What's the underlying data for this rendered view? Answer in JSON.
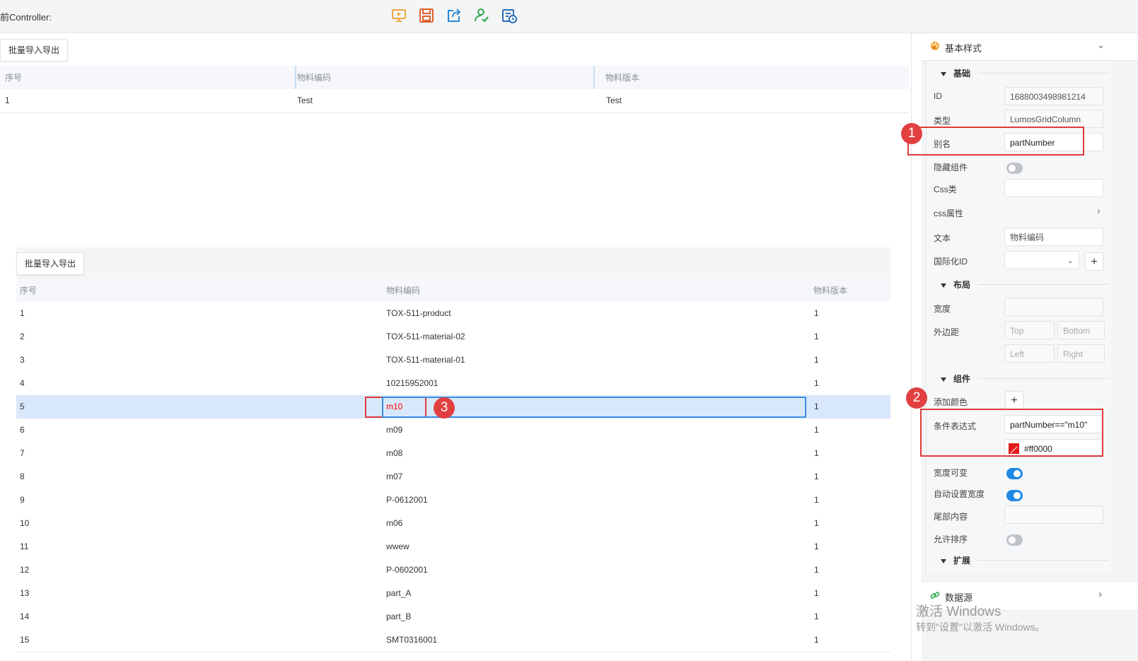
{
  "toolbar": {
    "controller_label": "前Controller:",
    "icons": [
      "preview-icon",
      "save-icon",
      "share-icon",
      "user-check-icon",
      "schedule-icon"
    ]
  },
  "canvas": {
    "top_grid": {
      "button_label": "批量导入导出",
      "columns": [
        "序号",
        "物料编码",
        "物料版本"
      ],
      "row": [
        "1",
        "Test",
        "Test"
      ]
    },
    "bottom_grid": {
      "button_label": "批量导入导出",
      "columns": [
        "序号",
        "物料编码",
        "物料版本"
      ],
      "rows": [
        [
          "1",
          "TOX-511-product",
          "1"
        ],
        [
          "2",
          "TOX-511-material-02",
          "1"
        ],
        [
          "3",
          "TOX-511-material-01",
          "1"
        ],
        [
          "4",
          "10215952001",
          "1"
        ],
        [
          "5",
          "m10",
          "1"
        ],
        [
          "6",
          "m09",
          "1"
        ],
        [
          "7",
          "m08",
          "1"
        ],
        [
          "8",
          "m07",
          "1"
        ],
        [
          "9",
          "P-0612001",
          "1"
        ],
        [
          "10",
          "m06",
          "1"
        ],
        [
          "11",
          "wwew",
          "1"
        ],
        [
          "12",
          "P-0602001",
          "1"
        ],
        [
          "13",
          "part_A",
          "1"
        ],
        [
          "14",
          "part_B",
          "1"
        ],
        [
          "15",
          "SMT0316001",
          "1"
        ]
      ],
      "selected_row": "5",
      "highlight_color": "#ff0000"
    }
  },
  "panel": {
    "header": "基本样式",
    "sections": {
      "basic": "基础",
      "layout": "布局",
      "component": "组件",
      "extend": "扩展"
    },
    "fields": {
      "id_label": "ID",
      "id_value": "1688003498981214",
      "type_label": "类型",
      "type_value": "LumosGridColumn",
      "alias_label": "别名",
      "alias_value": "partNumber",
      "hide_label": "隐藏组件",
      "css_class_label": "Css类",
      "css_attr_label": "css属性",
      "text_label": "文本",
      "text_value": "物料编码",
      "i18n_label": "国际化ID",
      "width_label": "宽度",
      "margin_label": "外边距",
      "margin_top": "Top",
      "margin_bottom": "Bottom",
      "margin_left": "Left",
      "margin_right": "Right",
      "add_color_label": "添加颜色",
      "condition_label": "条件表达式",
      "condition_value": "partNumber==\"m10\"",
      "color_value": "#ff0000",
      "resizable_label": "宽度可变",
      "auto_width_label": "自动设置宽度",
      "footer_label": "尾部内容",
      "sortable_label": "允许排序"
    },
    "toggles": {
      "hide": false,
      "resizable": true,
      "auto_width": true,
      "sortable": false
    },
    "datasource_label": "数据源"
  },
  "annotations": [
    "1",
    "2",
    "3"
  ],
  "watermark": {
    "line1": "激活 Windows",
    "line2": "转到\"设置\"以激活 Windows。"
  },
  "colors": {
    "accent": "#1e88e5",
    "annotation": "#e24040",
    "selected_row": "#d8e8fa"
  }
}
